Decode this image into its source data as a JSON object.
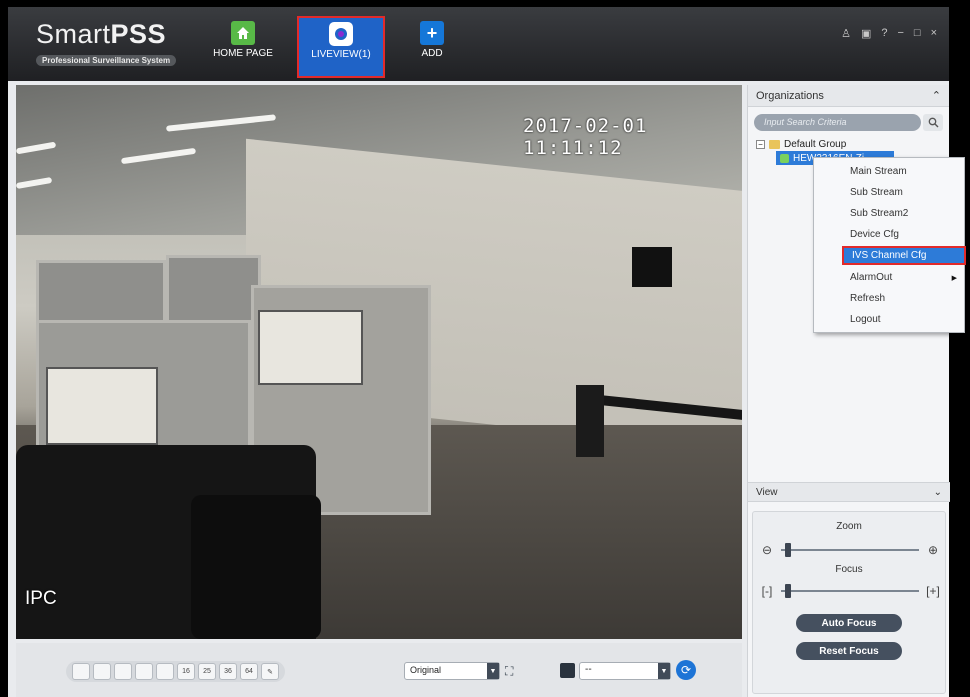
{
  "app": {
    "title_light": "Smart",
    "title_bold": "PSS",
    "subtitle": "Professional Surveillance System"
  },
  "nav": {
    "tabs": [
      {
        "label": "HOME PAGE",
        "icon": "home-icon"
      },
      {
        "label": "LIVEVIEW(1)",
        "icon": "camera-icon"
      },
      {
        "label": "ADD",
        "icon": "plus-icon"
      }
    ]
  },
  "window_controls": {
    "user": "♙",
    "lock": "🔒",
    "help": "?",
    "minimize": "−",
    "maximize": "□",
    "close": "×"
  },
  "video": {
    "timestamp": "2017-02-01 11:11:12",
    "label": "IPC"
  },
  "panel": {
    "organizations_title": "Organizations",
    "collapse_symbol": "⌃",
    "search_placeholder": "Input Search Criteria",
    "search_icon": "magnifier",
    "tree": {
      "group_label": "Default Group",
      "device_label": "HEW2316EN-Zi"
    },
    "view_title": "View",
    "view_symbol": "⌄",
    "zoom_label": "Zoom",
    "focus_label": "Focus",
    "auto_focus": "Auto Focus",
    "reset_focus": "Reset Focus"
  },
  "context_menu": {
    "items": [
      "Main Stream",
      "Sub Stream",
      "Sub Stream2",
      "Device Cfg",
      "IVS Channel Cfg",
      "AlarmOut",
      "Refresh",
      "Logout"
    ],
    "highlighted": "IVS Channel Cfg"
  },
  "bottombar": {
    "layout_buttons": [
      "",
      "",
      "",
      "",
      "",
      "16",
      "25",
      "36",
      "64"
    ],
    "aspect_value": "Original",
    "view_select_value": "--"
  },
  "colors": {
    "accent": "#2d7bd8",
    "highlight_border": "#e22a2a",
    "topbar": "#2a2c30"
  }
}
